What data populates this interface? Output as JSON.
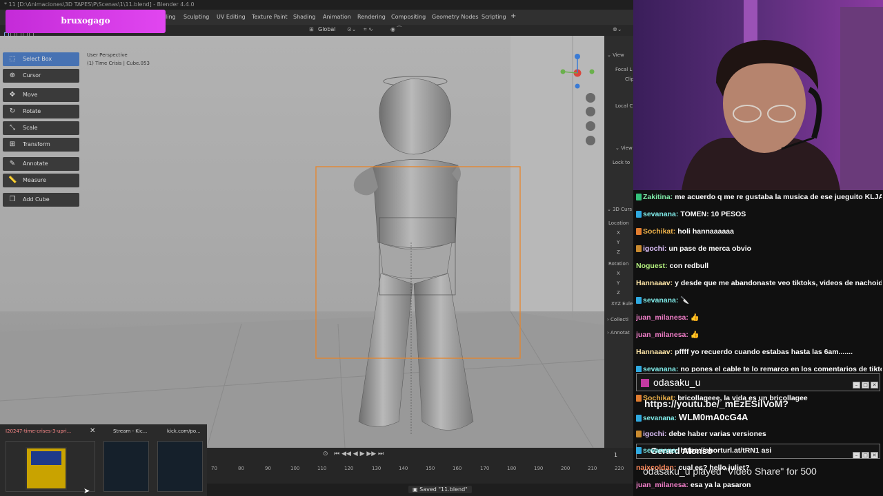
{
  "window": {
    "title": "* 11 [D:\\Animaciones\\3D TAPES\\P\\Scenas\\1\\11.blend] - Blender 4.4.0"
  },
  "streamer": {
    "name": "bruxogago"
  },
  "workspace_tabs": [
    "Sculpting",
    "UV Editing",
    "Texture Paint",
    "Shading",
    "Animation",
    "Rendering",
    "Compositing",
    "Geometry Nodes",
    "Scripting",
    "+"
  ],
  "workspace_tab_partial": "ling",
  "header": {
    "orientation": "Global"
  },
  "viewport": {
    "perspective_label": "User Perspective",
    "collection_label": "(1) Time Crisis | Cube.053"
  },
  "tools": [
    {
      "label": "Select Box",
      "icon": "select-box-icon",
      "active": true
    },
    {
      "label": "Cursor",
      "icon": "cursor-icon"
    },
    {
      "label": "Move",
      "icon": "move-icon"
    },
    {
      "label": "Rotate",
      "icon": "rotate-icon"
    },
    {
      "label": "Scale",
      "icon": "scale-icon"
    },
    {
      "label": "Transform",
      "icon": "transform-icon"
    },
    {
      "label": "Annotate",
      "icon": "annotate-icon"
    },
    {
      "label": "Measure",
      "icon": "measure-icon"
    },
    {
      "label": "Add Cube",
      "icon": "add-cube-icon"
    }
  ],
  "npanel": {
    "view": "View",
    "focal": "Focal L",
    "clip": "Clip",
    "local": "Local C",
    "view_lock": "View",
    "lock_to": "Lock to",
    "cursor": "3D Curs",
    "location": "Location",
    "x": "X",
    "y": "Y",
    "z": "Z",
    "rotation": "Rotation",
    "euler": "XYZ Eule",
    "collection": "Collecti",
    "annotations": "Annotat"
  },
  "timeline": {
    "current_frame": "1",
    "frames": [
      "70",
      "80",
      "90",
      "100",
      "110",
      "120",
      "130",
      "140",
      "150",
      "160",
      "170",
      "180",
      "190",
      "200",
      "210",
      "220"
    ]
  },
  "status": {
    "saved": "Saved \"11.blend\""
  },
  "previews": [
    {
      "title": "I20247-time-crises-3-upri..."
    },
    {
      "title": "Stream - Kic..."
    },
    {
      "title": "kick.com/po..."
    }
  ],
  "chat": {
    "messages": [
      {
        "user": "Zakitina:",
        "text": "me acuerdo q me re gustaba la musica de ese jueguito KLJASDÑLKJ",
        "color": "#7ee8a6",
        "badge": "#34c27a"
      },
      {
        "user": "sevanana:",
        "text": "TOMEN: 10 PESOS",
        "color": "#7ee8e6",
        "badge": "#2fa9e0"
      },
      {
        "user": "Sochikat:",
        "text": "holi hannaaaaaa",
        "color": "#f0b44c",
        "badge": "#e07c2f"
      },
      {
        "user": "igochi:",
        "text": "un pase de merca obvio",
        "color": "#e2c5ff",
        "badge": "#c98a2f"
      },
      {
        "user": "Noguest:",
        "text": "con redbull",
        "color": "#b4f07e",
        "badge": ""
      },
      {
        "user": "Hannaaav:",
        "text": "y desde que me abandonaste veo tiktoks, videos de nachoide y asi",
        "color": "#ffe6a8",
        "badge": ""
      },
      {
        "user": "sevanana:",
        "text": "",
        "color": "#7ee8e6",
        "badge": "#2fa9e0"
      },
      {
        "user": "juan_milanesa:",
        "text": "",
        "color": "#f07ec8",
        "badge": ""
      },
      {
        "user": "juan_milanesa:",
        "text": "",
        "color": "#f07ec8",
        "badge": ""
      },
      {
        "user": "Hannaaav:",
        "text": "pffff yo recuerdo cuando estabas hasta las 6am.......",
        "color": "#ffe6a8",
        "badge": ""
      },
      {
        "user": "sevanana:",
        "text": "no pones el cable te lo remarco en los comentarios de tiktok corte",
        "color": "#7ee8e6",
        "badge": "#2fa9e0"
      },
      {
        "user": "Sochikat:",
        "text": "bricollageee, la vida es un bricollagee",
        "color": "#f0b44c",
        "badge": "#e07c2f"
      },
      {
        "user": "sevanana:",
        "text": "WLM0mA0cG4A",
        "color": "#7ee8e6",
        "badge": "#2fa9e0"
      },
      {
        "user": "igochi:",
        "text": "debe haber varias versiones",
        "color": "#e2c5ff",
        "badge": "#c98a2f"
      },
      {
        "user": "sevanana:",
        "text": "https://shorturl.at/tRN1 asi",
        "color": "#7ee8e6",
        "badge": "#2fa9e0"
      },
      {
        "user": "naixcoldan:",
        "text": "cual es? hello juliet?",
        "color": "#ff8a5c",
        "badge": ""
      },
      {
        "user": "juan_milanesa:",
        "text": "esa ya la pasaron",
        "color": "#f07ec8",
        "badge": ""
      }
    ],
    "alert1": {
      "user": "odasaku_u",
      "link": "https://youtu.be/_mEzESilVoM?"
    },
    "alert2": {
      "user": "Gerard Alonso",
      "text": "odasaku_u played \"Video Share\" for 500"
    }
  }
}
